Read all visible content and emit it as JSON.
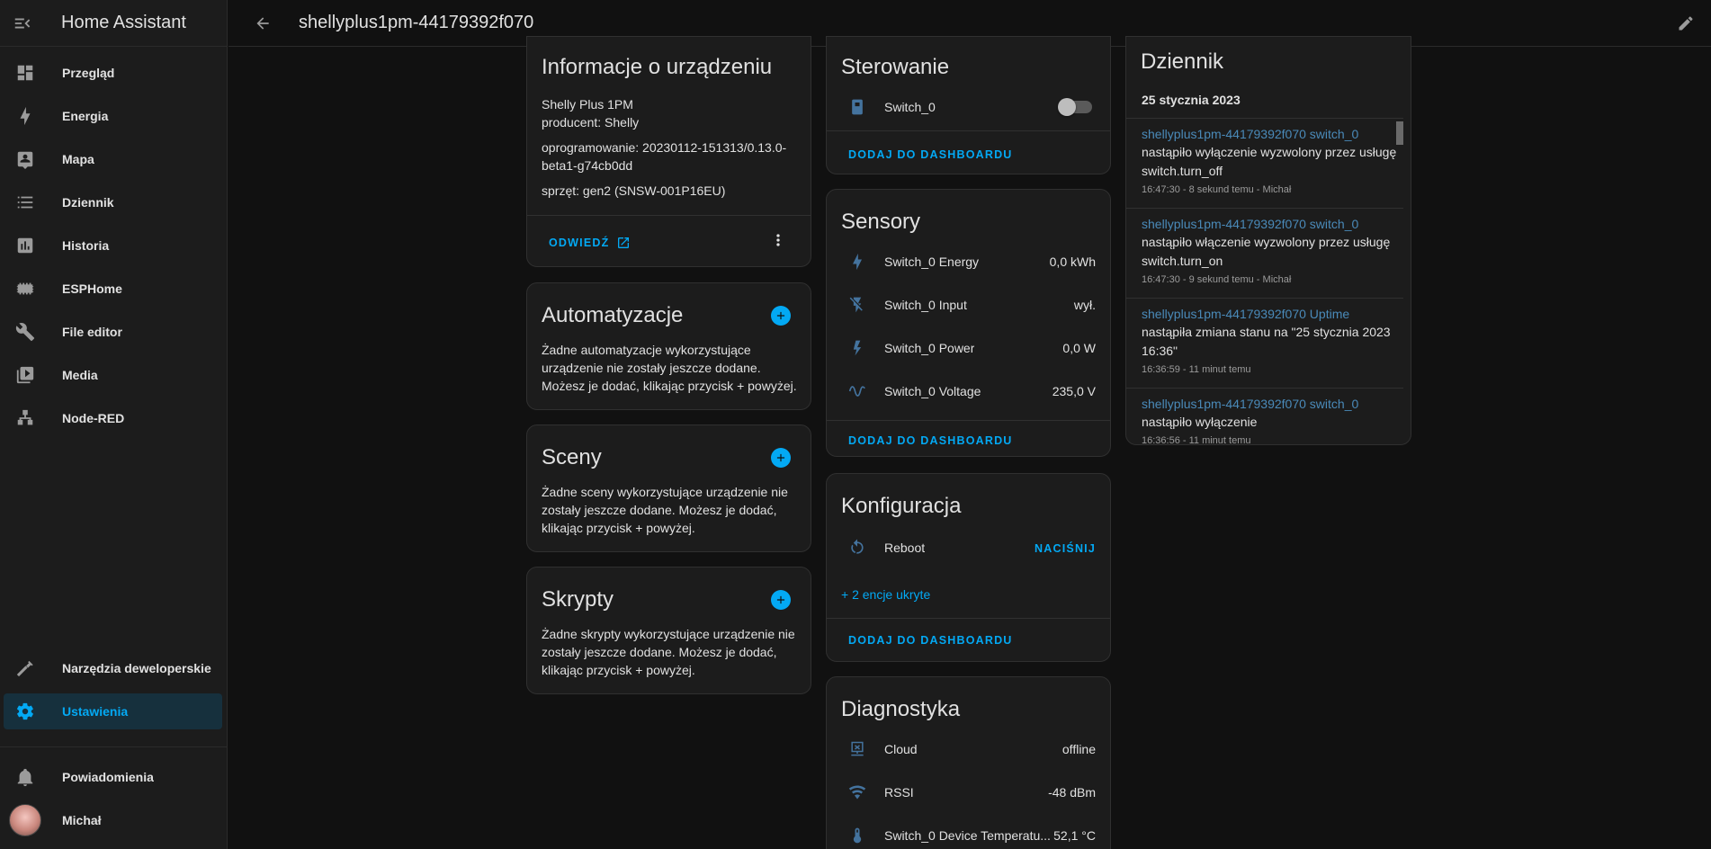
{
  "sidebar": {
    "title": "Home Assistant",
    "items": [
      {
        "label": "Przegląd",
        "icon": "dashboard-icon"
      },
      {
        "label": "Energia",
        "icon": "lightning-icon"
      },
      {
        "label": "Mapa",
        "icon": "map-icon"
      },
      {
        "label": "Dziennik",
        "icon": "list-icon"
      },
      {
        "label": "Historia",
        "icon": "chart-icon"
      },
      {
        "label": "ESPHome",
        "icon": "chip-icon"
      },
      {
        "label": "File editor",
        "icon": "wrench-icon"
      },
      {
        "label": "Media",
        "icon": "media-icon"
      },
      {
        "label": "Node-RED",
        "icon": "sitemap-icon"
      }
    ],
    "dev_tools": "Narzędzia deweloperskie",
    "settings": "Ustawienia",
    "notifications": "Powiadomienia",
    "user": "Michał"
  },
  "header": {
    "title": "shellyplus1pm-44179392f070"
  },
  "device_info": {
    "title": "Informacje o urządzeniu",
    "model": "Shelly Plus 1PM",
    "manufacturer": "producent: Shelly",
    "firmware": "oprogramowanie: 20230112-151313/0.13.0-beta1-g74cb0dd",
    "hardware": "sprzęt: gen2 (SNSW-001P16EU)",
    "visit": "ODWIEDŹ"
  },
  "automations": {
    "title": "Automatyzacje",
    "text": "Żadne automatyzacje wykorzystujące urządzenie nie zostały jeszcze dodane. Możesz je dodać, klikając przycisk + powyżej."
  },
  "scenes": {
    "title": "Sceny",
    "text": "Żadne sceny wykorzystujące urządzenie nie zostały jeszcze dodane. Możesz je dodać, klikając przycisk + powyżej."
  },
  "scripts": {
    "title": "Skrypty",
    "text": "Żadne skrypty wykorzystujące urządzenie nie zostały jeszcze dodane. Możesz je dodać, klikając przycisk + powyżej."
  },
  "controls": {
    "title": "Sterowanie",
    "switch_name": "Switch_0",
    "switch_on": false,
    "add": "DODAJ DO DASHBOARDU"
  },
  "sensors": {
    "title": "Sensory",
    "rows": [
      {
        "name": "Switch_0 Energy",
        "value": "0,0 kWh",
        "icon": "lightning-icon"
      },
      {
        "name": "Switch_0 Input",
        "value": "wył.",
        "icon": "flash-off-icon"
      },
      {
        "name": "Switch_0 Power",
        "value": "0,0 W",
        "icon": "power-icon"
      },
      {
        "name": "Switch_0 Voltage",
        "value": "235,0 V",
        "icon": "sine-wave-icon"
      }
    ],
    "add": "DODAJ DO DASHBOARDU"
  },
  "config": {
    "title": "Konfiguracja",
    "reboot": "Reboot",
    "press": "NACIŚNIJ",
    "hidden": "+ 2 encje ukryte",
    "add": "DODAJ DO DASHBOARDU"
  },
  "diagnostics": {
    "title": "Diagnostyka",
    "rows": [
      {
        "name": "Cloud",
        "value": "offline",
        "icon": "cloud-network-icon"
      },
      {
        "name": "RSSI",
        "value": "-48 dBm",
        "icon": "wifi-icon"
      },
      {
        "name": "Switch_0 Device Temperatu...",
        "value": "52,1 °C",
        "icon": "thermometer-icon"
      }
    ]
  },
  "logbook": {
    "title": "Dziennik",
    "date": "25 stycznia 2023",
    "entries": [
      {
        "entity": "shellyplus1pm-44179392f070 switch_0",
        "message": "nastąpiło wyłączenie wyzwolony przez usługę switch.turn_off",
        "meta": "16:47:30 - 8 sekund temu - Michał"
      },
      {
        "entity": "shellyplus1pm-44179392f070 switch_0",
        "message": "nastąpiło włączenie wyzwolony przez usługę switch.turn_on",
        "meta": "16:47:30 - 9 sekund temu - Michał"
      },
      {
        "entity": "shellyplus1pm-44179392f070 Uptime",
        "message": "nastąpiła zmiana stanu na \"25 stycznia 2023 16:36\"",
        "meta": "16:36:59 - 11 minut temu"
      },
      {
        "entity": "shellyplus1pm-44179392f070 switch_0",
        "message": "nastąpiło wyłączenie",
        "meta": "16:36:56 - 11 minut temu"
      }
    ]
  },
  "colors": {
    "accent": "#03a9f4",
    "background": "#111111",
    "card": "#1c1c1c",
    "entity_link": "#4a8ab9"
  }
}
